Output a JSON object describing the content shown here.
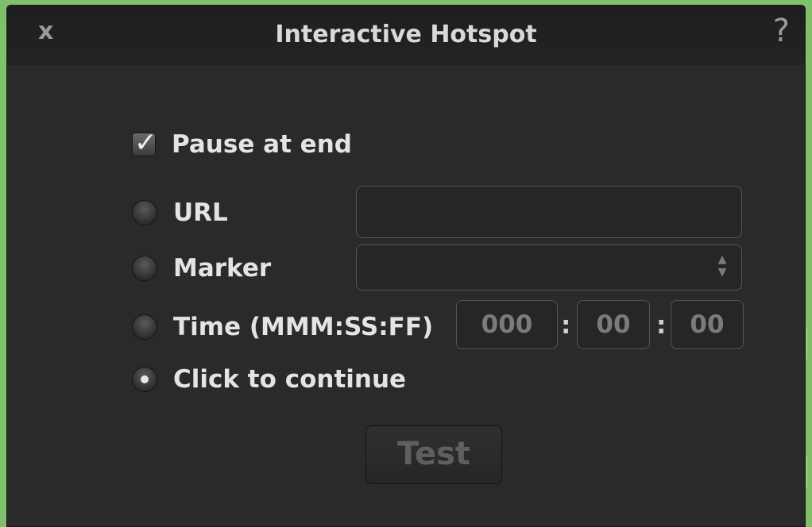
{
  "dialog": {
    "title": "Interactive Hotspot",
    "close_label": "x",
    "help_label": "?"
  },
  "options": {
    "pause_at_end": {
      "label": "Pause at end",
      "checked": true
    },
    "url": {
      "label": "URL",
      "selected": false,
      "value": ""
    },
    "marker": {
      "label": "Marker",
      "selected": false,
      "value": ""
    },
    "time": {
      "label": "Time (MMM:SS:FF)",
      "selected": false,
      "minutes": "000",
      "seconds": "00",
      "frames": "00",
      "separator": ":"
    },
    "click_to_continue": {
      "label": "Click to continue",
      "selected": true
    }
  },
  "buttons": {
    "test_label": "Test"
  },
  "colors": {
    "background": "#7fc06b",
    "panel": "#2a2a2a",
    "text": "#e4e4e4",
    "disabled_text": "#5f5f5f"
  }
}
